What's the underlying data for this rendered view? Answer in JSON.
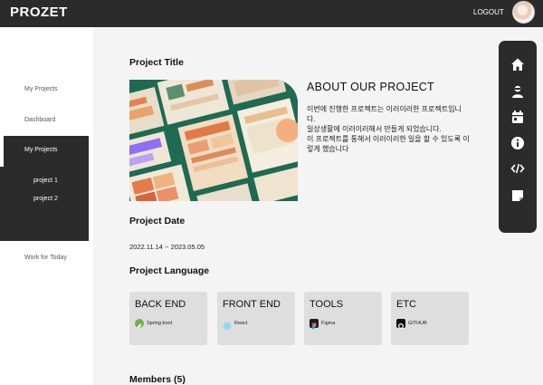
{
  "header": {
    "brand": "PROZET",
    "logout_label": "LOGOUT"
  },
  "sidebar": {
    "items": [
      {
        "label": "My Projects"
      },
      {
        "label": "Dashboard"
      },
      {
        "label": "My Projects"
      },
      {
        "label": "Work for Today"
      }
    ],
    "subitems": [
      {
        "label": "project 1"
      },
      {
        "label": "project 2"
      }
    ]
  },
  "main": {
    "project_title_heading": "Project Title",
    "about_title": "ABOUT OUR PROJECT",
    "about_lines": [
      "이번에 진행한 프로젝트는 이러이러한 프로젝트입니",
      "다.",
      "일상생활에 이러이러해서 만들게 되었습니다.",
      "이 프로젝트를 통해서 이러이러한 일을 할 수 있도록 이",
      "렇게 했습니다"
    ],
    "date_heading": "Project Date",
    "date_value": "2022.11.14 ~ 2023.05.05",
    "language_heading": "Project Language",
    "language_cards": [
      {
        "title": "BACK END",
        "tech": "Spring boot",
        "icon": "spring-icon",
        "color": "#6db33f"
      },
      {
        "title": "FRONT END",
        "tech": "React",
        "icon": "react-icon",
        "color": "#61dafb"
      },
      {
        "title": "TOOLS",
        "tech": "Figma",
        "icon": "figma-icon",
        "color": "#f24e1e"
      },
      {
        "title": "ETC",
        "tech": "GITHUB",
        "icon": "github-icon",
        "color": "#111111"
      }
    ],
    "members_heading": "Members (5)"
  },
  "right_rail": {
    "icons": [
      "home-icon",
      "user-icon",
      "calendar-icon",
      "info-icon",
      "code-icon",
      "note-icon"
    ]
  }
}
